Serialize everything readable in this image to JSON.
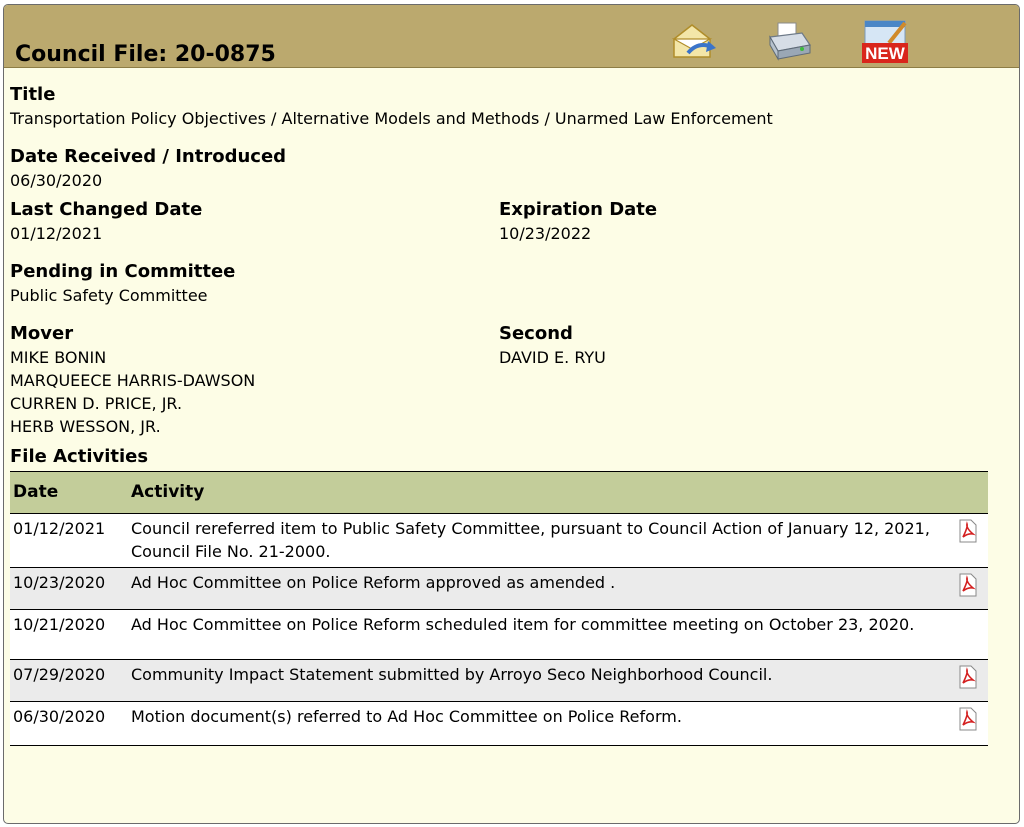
{
  "header": {
    "title": "Council File: 20-0875",
    "icons": {
      "email": "email-icon",
      "print": "print-icon",
      "new": "new-icon",
      "new_label": "NEW"
    }
  },
  "fields": {
    "title_label": "Title",
    "title_value": "Transportation Policy Objectives / Alternative Models and Methods / Unarmed Law Enforcement",
    "date_received_label": "Date Received / Introduced",
    "date_received_value": "06/30/2020",
    "last_changed_label": "Last Changed Date",
    "last_changed_value": "01/12/2021",
    "expiration_label": "Expiration Date",
    "expiration_value": "10/23/2022",
    "pending_label": "Pending in Committee",
    "pending_value": "Public Safety Committee",
    "mover_label": "Mover",
    "movers": [
      "MIKE BONIN",
      "MARQUEECE HARRIS-DAWSON",
      "CURREN D. PRICE, JR.",
      "HERB WESSON, JR."
    ],
    "second_label": "Second",
    "second_value": "DAVID E. RYU"
  },
  "activities": {
    "section_label": "File Activities",
    "columns": [
      "Date",
      "Activity"
    ],
    "rows": [
      {
        "date": "01/12/2021",
        "activity": "Council rereferred item to Public Safety Committee, pursuant to Council Action of January 12, 2021, Council File No. 21-2000.",
        "pdf": true
      },
      {
        "date": "10/23/2020",
        "activity": "Ad Hoc Committee on Police Reform approved as amended .",
        "pdf": true
      },
      {
        "date": "10/21/2020",
        "activity": "Ad Hoc Committee on Police Reform scheduled item for committee meeting on October 23, 2020.",
        "pdf": false
      },
      {
        "date": "07/29/2020",
        "activity": "Community Impact Statement submitted by Arroyo Seco Neighborhood Council.",
        "pdf": true
      },
      {
        "date": "06/30/2020",
        "activity": "Motion document(s) referred to Ad Hoc Committee on Police Reform.",
        "pdf": true
      }
    ]
  },
  "colors": {
    "header_bg": "#bba96e",
    "panel_bg": "#fdfde6",
    "table_head_bg": "#c3cd9a",
    "alt_row_bg": "#ebebeb",
    "new_badge": "#d9261c"
  }
}
